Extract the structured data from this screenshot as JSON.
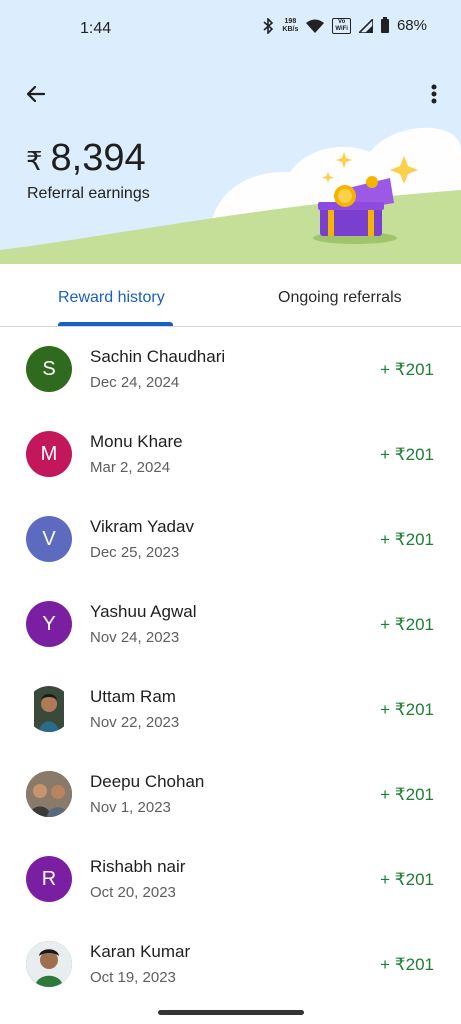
{
  "status_bar": {
    "time": "1:44",
    "speed_value": "198",
    "speed_unit": "KB/s",
    "vowifi_top": "Vo",
    "vowifi_bottom": "WiFi",
    "battery": "68%"
  },
  "header": {
    "currency_symbol": "₹",
    "amount": "8,394",
    "label": "Referral earnings"
  },
  "tabs": {
    "reward_history": "Reward history",
    "ongoing_referrals": "Ongoing referrals",
    "active": "reward_history"
  },
  "rewards": [
    {
      "name": "Sachin Chaudhari",
      "date": "Dec 24, 2024",
      "amount": "+ ₹201",
      "initial": "S",
      "avatar_color": "#2f6b1e"
    },
    {
      "name": "Monu Khare",
      "date": "Mar 2, 2024",
      "amount": "+ ₹201",
      "initial": "M",
      "avatar_color": "#c2185b"
    },
    {
      "name": "Vikram Yadav",
      "date": "Dec 25, 2023",
      "amount": "+ ₹201",
      "initial": "V",
      "avatar_color": "#5c6bc0"
    },
    {
      "name": "Yashuu Agwal",
      "date": "Nov 24, 2023",
      "amount": "+ ₹201",
      "initial": "Y",
      "avatar_color": "#7b1fa2"
    },
    {
      "name": "Uttam Ram",
      "date": "Nov 22, 2023",
      "amount": "+ ₹201",
      "initial": "",
      "avatar_color": "#3a4a3a"
    },
    {
      "name": "Deepu Chohan",
      "date": "Nov 1, 2023",
      "amount": "+ ₹201",
      "initial": "",
      "avatar_color": "#6b5a4a"
    },
    {
      "name": "Rishabh nair",
      "date": "Oct 20, 2023",
      "amount": "+ ₹201",
      "initial": "R",
      "avatar_color": "#7b1fa2"
    },
    {
      "name": "Karan Kumar",
      "date": "Oct 19, 2023",
      "amount": "+ ₹201",
      "initial": "",
      "avatar_color": "#4a6a3a"
    }
  ],
  "colors": {
    "accent": "#1a5fc4",
    "reward_green": "#1e7e34",
    "header_bg": "#dcedfd",
    "hill": "#c5de98"
  },
  "icons": {
    "back": "arrow-left-icon",
    "more": "more-vert-icon",
    "illustration": "treasure-chest-illustration"
  }
}
